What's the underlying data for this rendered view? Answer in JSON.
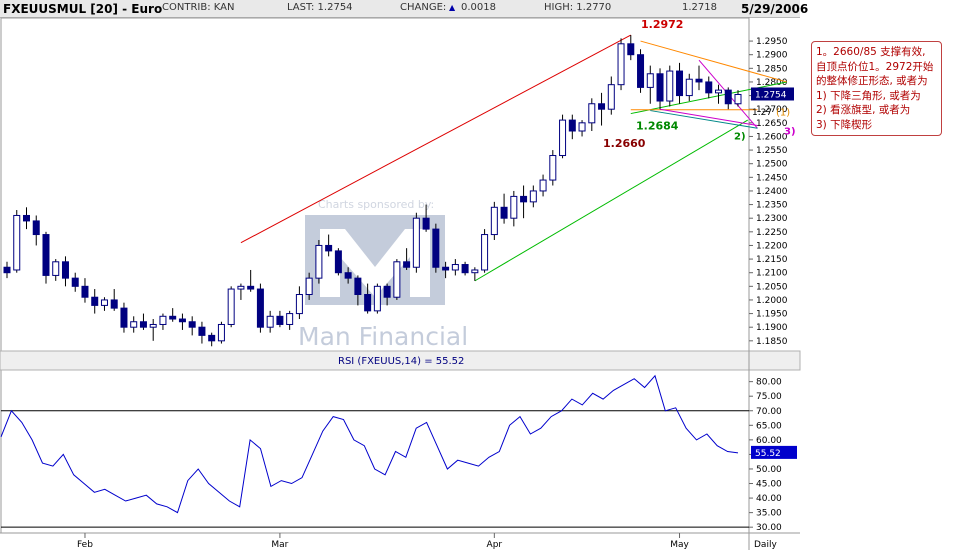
{
  "header": {
    "symbol": "FXEUUSMUL [20] - Euro",
    "contrib_label": "CONTRIB: KAN",
    "last_label": "LAST: 1.2754",
    "change_label": "CHANGE:",
    "change_value": "0.0018",
    "high_label": "HIGH: 1.2770",
    "low_value": "1.2718",
    "date": "5/29/2006"
  },
  "annotation": {
    "text": "1。2660/85 支撑有效, 自顶点价位1。2972开始的整体修正形态, 或者为\n1) 下降三角形, 或者为\n2) 看涨旗型, 或者为\n3) 下降楔形"
  },
  "watermark": {
    "sponsor_text": "Charts sponsored by:",
    "brand_text": "Man Financial"
  },
  "chart_data": [
    {
      "type": "candlestick",
      "ylim": [
        1.182,
        1.302
      ],
      "yticks": [
        "1.2950",
        "1.2900",
        "1.2850",
        "1.2800",
        "1.2750",
        "1.2700",
        "1.2650",
        "1.2600",
        "1.2550",
        "1.2500",
        "1.2450",
        "1.2400",
        "1.2350",
        "1.2300",
        "1.2250",
        "1.2200",
        "1.2150",
        "1.2100",
        "1.2050",
        "1.2000",
        "1.1950",
        "1.1900",
        "1.1850"
      ],
      "last_price_label": "1.2754",
      "other_price_label": "1.27",
      "annotations": [
        {
          "text": "1.2972",
          "color": "#cc0000"
        },
        {
          "text": "1.2684",
          "color": "#008800"
        },
        {
          "text": "1.2660",
          "color": "#880000"
        },
        {
          "text": "(1)",
          "color": "#e08a00"
        },
        {
          "text": "2)",
          "color": "#008800"
        },
        {
          "text": "3)",
          "color": "#cc00cc"
        }
      ],
      "trendlines": [
        {
          "color": "#dd0000",
          "from": [
            24,
            1.221
          ],
          "to": [
            64,
            1.2972
          ]
        },
        {
          "color": "#00bb00",
          "from": [
            48,
            1.207
          ],
          "to": [
            76,
            1.266
          ]
        },
        {
          "color": "#00bb00",
          "from": [
            64,
            1.2684
          ],
          "to": [
            80,
            1.28
          ]
        },
        {
          "color": "#ff8800",
          "from": [
            65,
            1.295
          ],
          "to": [
            80,
            1.28
          ]
        },
        {
          "color": "#ff8800",
          "from": [
            64,
            1.2698
          ],
          "to": [
            77,
            1.2698
          ]
        },
        {
          "color": "#cc00cc",
          "from": [
            71,
            1.288
          ],
          "to": [
            77,
            1.263
          ]
        },
        {
          "color": "#cc00cc",
          "from": [
            67,
            1.27
          ],
          "to": [
            77,
            1.264
          ]
        },
        {
          "color": "#008888",
          "from": [
            66,
            1.2695
          ],
          "to": [
            77,
            1.263
          ]
        }
      ],
      "ohlc": [
        [
          1.212,
          1.214,
          1.208,
          1.21
        ],
        [
          1.211,
          1.233,
          1.21,
          1.231
        ],
        [
          1.231,
          1.234,
          1.226,
          1.229
        ],
        [
          1.229,
          1.231,
          1.22,
          1.224
        ],
        [
          1.224,
          1.225,
          1.206,
          1.209
        ],
        [
          1.209,
          1.215,
          1.207,
          1.214
        ],
        [
          1.214,
          1.216,
          1.205,
          1.208
        ],
        [
          1.208,
          1.21,
          1.203,
          1.205
        ],
        [
          1.205,
          1.208,
          1.199,
          1.201
        ],
        [
          1.201,
          1.204,
          1.195,
          1.198
        ],
        [
          1.198,
          1.201,
          1.196,
          1.2
        ],
        [
          1.2,
          1.204,
          1.196,
          1.197
        ],
        [
          1.197,
          1.199,
          1.188,
          1.19
        ],
        [
          1.19,
          1.194,
          1.188,
          1.192
        ],
        [
          1.192,
          1.195,
          1.189,
          1.19
        ],
        [
          1.19,
          1.193,
          1.185,
          1.191
        ],
        [
          1.191,
          1.195,
          1.189,
          1.194
        ],
        [
          1.194,
          1.197,
          1.192,
          1.193
        ],
        [
          1.193,
          1.195,
          1.189,
          1.192
        ],
        [
          1.192,
          1.194,
          1.187,
          1.19
        ],
        [
          1.19,
          1.192,
          1.184,
          1.187
        ],
        [
          1.187,
          1.188,
          1.183,
          1.185
        ],
        [
          1.185,
          1.192,
          1.184,
          1.191
        ],
        [
          1.191,
          1.205,
          1.19,
          1.204
        ],
        [
          1.204,
          1.206,
          1.2,
          1.205
        ],
        [
          1.205,
          1.211,
          1.203,
          1.204
        ],
        [
          1.204,
          1.206,
          1.188,
          1.19
        ],
        [
          1.19,
          1.196,
          1.188,
          1.194
        ],
        [
          1.194,
          1.196,
          1.19,
          1.191
        ],
        [
          1.191,
          1.196,
          1.189,
          1.195
        ],
        [
          1.195,
          1.205,
          1.193,
          1.202
        ],
        [
          1.202,
          1.21,
          1.2,
          1.208
        ],
        [
          1.208,
          1.222,
          1.206,
          1.22
        ],
        [
          1.22,
          1.224,
          1.216,
          1.218
        ],
        [
          1.218,
          1.219,
          1.209,
          1.21
        ],
        [
          1.21,
          1.212,
          1.206,
          1.208
        ],
        [
          1.208,
          1.209,
          1.198,
          1.202
        ],
        [
          1.202,
          1.206,
          1.195,
          1.196
        ],
        [
          1.196,
          1.206,
          1.195,
          1.205
        ],
        [
          1.205,
          1.206,
          1.198,
          1.201
        ],
        [
          1.201,
          1.215,
          1.2,
          1.214
        ],
        [
          1.214,
          1.219,
          1.211,
          1.212
        ],
        [
          1.212,
          1.232,
          1.21,
          1.23
        ],
        [
          1.23,
          1.235,
          1.225,
          1.226
        ],
        [
          1.226,
          1.228,
          1.21,
          1.212
        ],
        [
          1.212,
          1.214,
          1.208,
          1.211
        ],
        [
          1.211,
          1.215,
          1.209,
          1.213
        ],
        [
          1.213,
          1.214,
          1.209,
          1.21
        ],
        [
          1.21,
          1.212,
          1.207,
          1.211
        ],
        [
          1.211,
          1.226,
          1.21,
          1.224
        ],
        [
          1.224,
          1.236,
          1.222,
          1.234
        ],
        [
          1.234,
          1.239,
          1.228,
          1.23
        ],
        [
          1.23,
          1.24,
          1.227,
          1.238
        ],
        [
          1.238,
          1.242,
          1.23,
          1.236
        ],
        [
          1.236,
          1.242,
          1.234,
          1.24
        ],
        [
          1.24,
          1.246,
          1.238,
          1.244
        ],
        [
          1.244,
          1.255,
          1.242,
          1.253
        ],
        [
          1.253,
          1.268,
          1.252,
          1.266
        ],
        [
          1.266,
          1.268,
          1.259,
          1.262
        ],
        [
          1.262,
          1.266,
          1.26,
          1.265
        ],
        [
          1.265,
          1.274,
          1.262,
          1.272
        ],
        [
          1.272,
          1.276,
          1.264,
          1.27
        ],
        [
          1.27,
          1.282,
          1.268,
          1.279
        ],
        [
          1.279,
          1.296,
          1.277,
          1.294
        ],
        [
          1.294,
          1.2972,
          1.288,
          1.29
        ],
        [
          1.29,
          1.292,
          1.276,
          1.278
        ],
        [
          1.278,
          1.286,
          1.272,
          1.283
        ],
        [
          1.283,
          1.285,
          1.27,
          1.273
        ],
        [
          1.273,
          1.286,
          1.271,
          1.284
        ],
        [
          1.284,
          1.287,
          1.272,
          1.275
        ],
        [
          1.275,
          1.283,
          1.273,
          1.281
        ],
        [
          1.281,
          1.286,
          1.277,
          1.28
        ],
        [
          1.28,
          1.282,
          1.274,
          1.276
        ],
        [
          1.276,
          1.279,
          1.272,
          1.277
        ],
        [
          1.277,
          1.278,
          1.27,
          1.272
        ],
        [
          1.272,
          1.277,
          1.271,
          1.2754
        ]
      ],
      "month_labels": [
        {
          "label": "Feb",
          "index": 8
        },
        {
          "label": "Mar",
          "index": 28
        },
        {
          "label": "Apr",
          "index": 50
        },
        {
          "label": "May",
          "index": 69
        }
      ],
      "period_label": "Daily"
    },
    {
      "type": "line",
      "title": "RSI (FXEUUS,14) = 55.52",
      "ylim": [
        28,
        84
      ],
      "yticks": [
        "80.00",
        "75.00",
        "70.00",
        "65.00",
        "60.00",
        "55.00",
        "50.00",
        "45.00",
        "40.00",
        "35.00",
        "30.00"
      ],
      "reference_lines": [
        70,
        30
      ],
      "last_value_label": "55.52",
      "values": [
        61,
        70,
        66,
        60,
        52,
        51,
        55,
        48,
        45,
        42,
        43,
        41,
        39,
        40,
        41,
        38,
        37,
        35,
        46,
        50,
        45,
        42,
        39,
        37,
        60,
        57,
        44,
        46,
        45,
        47,
        55,
        63,
        68,
        67,
        60,
        58,
        50,
        48,
        56,
        54,
        64,
        66,
        58,
        50,
        53,
        52,
        51,
        54,
        56,
        65,
        68,
        62,
        64,
        68,
        70,
        74,
        72,
        76,
        74,
        77,
        79,
        81,
        78,
        82,
        70,
        71,
        64,
        60,
        62,
        58,
        56,
        55.52
      ]
    }
  ]
}
